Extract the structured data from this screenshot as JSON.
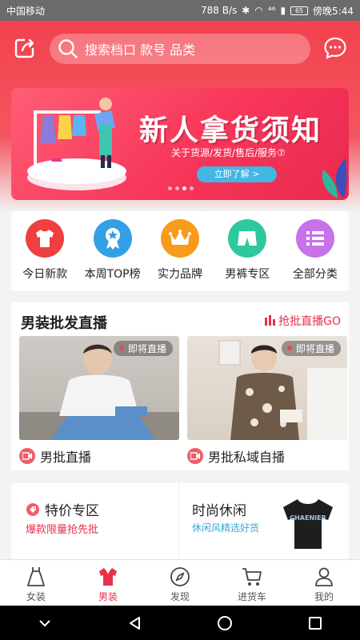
{
  "status_bar": {
    "carrier": "中国移动",
    "speed": "788 B/s",
    "signal_label": "⁴⁶",
    "battery": "65",
    "time": "傍晚5:44"
  },
  "search": {
    "placeholder": "搜索档口 款号 品类"
  },
  "banner": {
    "title": "新人拿货须知",
    "subtitle": "关于货源/发货/售后/服务⑦",
    "button": "立即了解 >"
  },
  "categories": [
    {
      "label": "今日新款",
      "color": "#ef3f3f",
      "icon": "tshirt-icon"
    },
    {
      "label": "本周TOP榜",
      "color": "#33a0e6",
      "icon": "ribbon-star-icon"
    },
    {
      "label": "实力品牌",
      "color": "#f89a1a",
      "icon": "crown-icon"
    },
    {
      "label": "男裤专区",
      "color": "#2fc79c",
      "icon": "shorts-icon"
    },
    {
      "label": "全部分类",
      "color": "#c772e9",
      "icon": "list-icon"
    }
  ],
  "live": {
    "title": "男装批发直播",
    "link": "抢批直播GO",
    "items": [
      {
        "badge": "即将直播",
        "label": "男批直播"
      },
      {
        "badge": "即将直播",
        "label": "男批私域自播"
      }
    ]
  },
  "promo": {
    "left_title": "特价专区",
    "left_sub": "爆款限量抢先批",
    "right_title": "时尚休闲",
    "right_sub": "休闲风精选好货",
    "shirt_text": "CHAENIER"
  },
  "tabs": [
    {
      "label": "女装",
      "icon": "dress-icon"
    },
    {
      "label": "男装",
      "icon": "shirt-icon"
    },
    {
      "label": "发现",
      "icon": "compass-icon"
    },
    {
      "label": "进货车",
      "icon": "cart-icon"
    },
    {
      "label": "我的",
      "icon": "user-icon"
    }
  ],
  "colors": {
    "brand": "#e8304a",
    "header": "#f2424e"
  }
}
